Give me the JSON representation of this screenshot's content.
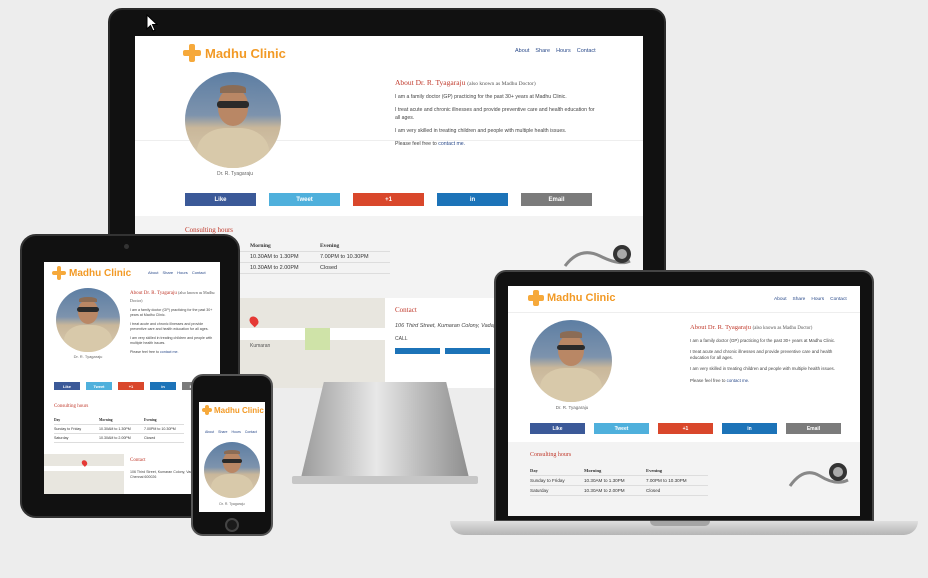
{
  "site": {
    "name": "Madhu Clinic",
    "nav": [
      "About",
      "Share",
      "Hours",
      "Contact"
    ],
    "caption": "Dr. R. Tyagaraju",
    "about_title": "About Dr. R. Tyagaraju",
    "about_aka": "(also known as Madhu Doctor)",
    "p1": "I am a family doctor (GP) practicing for the past 30+ years at Madhu Clinic.",
    "p2": "I treat acute and chronic illnesses and provide preventive care and health education for all ages.",
    "p3": "I am very skilled in treating children and people with multiple health issues.",
    "p4_pre": "Please feel free to",
    "p4_link": "contact me.",
    "share": {
      "like": "Like",
      "tweet": "Tweet",
      "plus": "+1",
      "in": "in",
      "email": "Email"
    },
    "hours_title": "Consulting hours",
    "hours_headers": [
      "Day",
      "Morning",
      "Evening"
    ],
    "hours_rows": [
      [
        "Sunday to Friday",
        "10.30AM to 1.30PM",
        "7.00PM to 10.30PM"
      ],
      [
        "Saturday",
        "10.30AM to 2.00PM",
        "Closed"
      ]
    ],
    "contact_title": "Contact",
    "address": "106 Third Street, Kumaran Colony, Vadapalani, Chennai 600026",
    "address_short": "106 Third Street, Kumaran Colony, Vadapa",
    "call": "CALL",
    "map_label": "Kumaran"
  },
  "colors": {
    "accent": "#c0392b",
    "brand": "#f29a26",
    "nav": "#2a4a8a"
  }
}
